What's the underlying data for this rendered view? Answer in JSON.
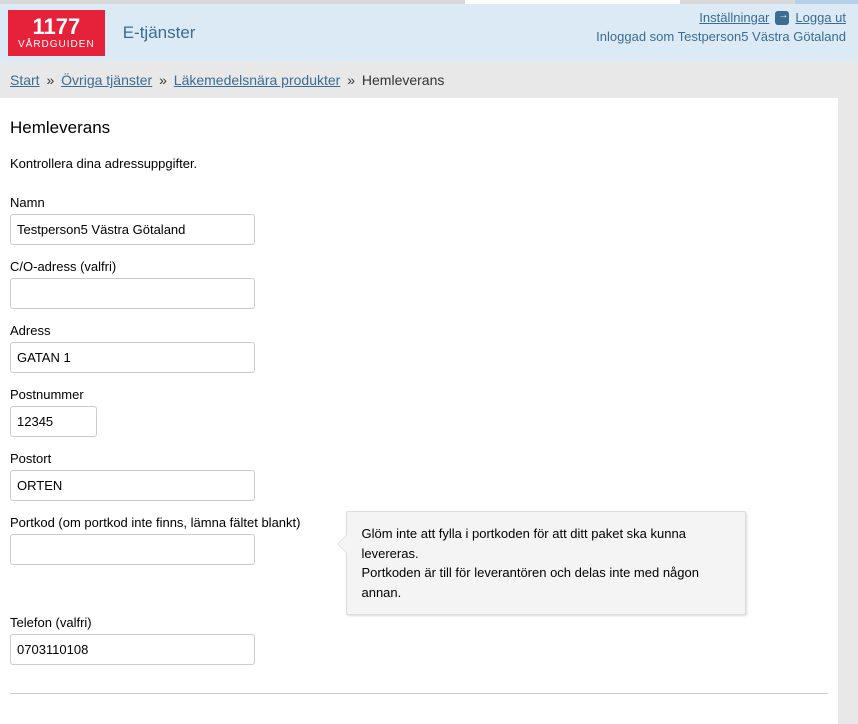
{
  "header": {
    "logo_main": "1177",
    "logo_sub": "VÅRDGUIDEN",
    "etjanster": "E-tjänster",
    "settings_link": "Inställningar",
    "logout_link": "Logga ut",
    "logged_in_prefix": "Inloggad som ",
    "logged_in_user": "Testperson5 Västra Götaland"
  },
  "breadcrumb": {
    "items": [
      {
        "label": "Start",
        "link": true
      },
      {
        "label": "Övriga tjänster",
        "link": true
      },
      {
        "label": "Läkemedelsnära produkter",
        "link": true
      },
      {
        "label": "Hemleverans",
        "link": false
      }
    ],
    "separator": "»"
  },
  "page": {
    "title": "Hemleverans",
    "instruction": "Kontrollera dina adressuppgifter."
  },
  "form": {
    "namn": {
      "label": "Namn",
      "value": "Testperson5 Västra Götaland"
    },
    "co": {
      "label": "C/O-adress (valfri)",
      "value": ""
    },
    "adress": {
      "label": "Adress",
      "value": "GATAN 1"
    },
    "postnummer": {
      "label": "Postnummer",
      "value": "12345"
    },
    "postort": {
      "label": "Postort",
      "value": "ORTEN"
    },
    "portkod": {
      "label": "Portkod (om portkod inte finns, lämna fältet blankt)",
      "value": "",
      "tooltip_line1": "Glöm inte att fylla i portkoden för att ditt paket ska kunna levereras.",
      "tooltip_line2": "Portkoden är till för leverantören och delas inte med någon annan."
    },
    "telefon": {
      "label": "Telefon (valfri)",
      "value": "0703110108"
    }
  }
}
